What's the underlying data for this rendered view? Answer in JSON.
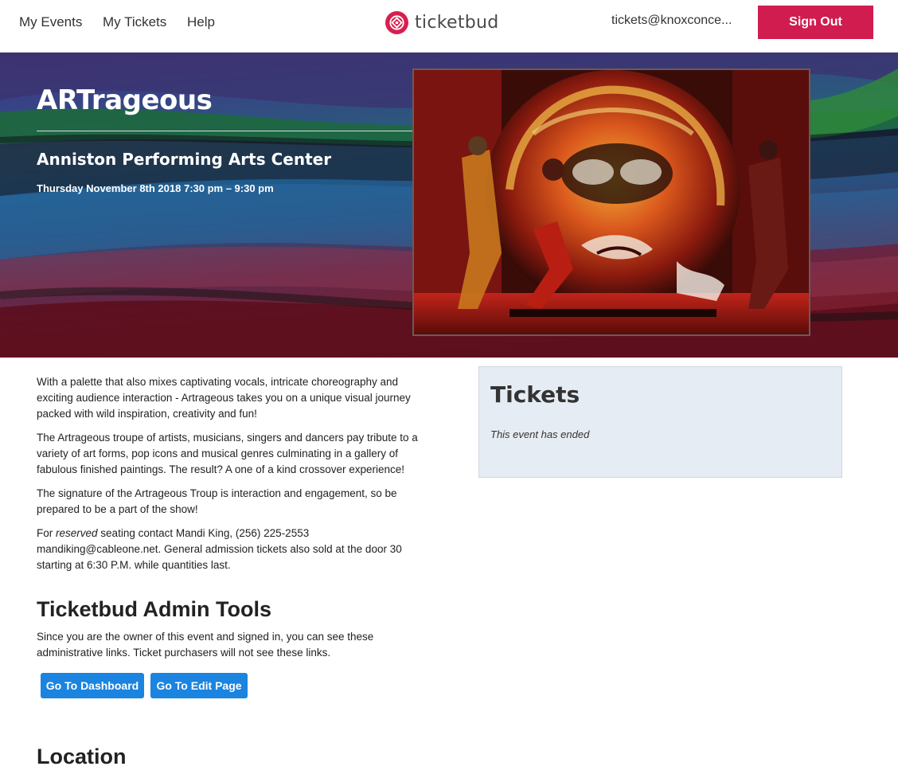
{
  "nav": {
    "links": [
      "My Events",
      "My Tickets",
      "Help"
    ],
    "logo_text": "ticketbud",
    "user_email": "tickets@knoxconce...",
    "signout_label": "Sign Out"
  },
  "event": {
    "title": "ARTrageous",
    "venue": "Anniston Performing Arts Center",
    "datetime": "Thursday November 8th 2018 7:30 pm –  9:30 pm",
    "description": [
      "With a palette that also mixes captivating vocals, intricate choreography and exciting audience interaction - Artrageous takes you on a unique visual journey packed with wild inspiration, creativity and fun!",
      "The Artrageous troupe of artists, musicians, singers and dancers pay tribute to a variety of art forms, pop icons and musical genres culminating in a gallery of fabulous finished paintings. The result? A one of a kind crossover experience!",
      "The signature of the Artrageous Troup is interaction and engagement, so be prepared to be a part of the show!"
    ],
    "reserved_prefix": "For ",
    "reserved_word": "reserved",
    "reserved_rest": " seating contact Mandi King, (256) 225-2553 mandiking@cableone.net. General admission tickets also sold at the door 30 starting at 6:30 P.M. while quantities last."
  },
  "tickets": {
    "title": "Tickets",
    "status": "This event has ended"
  },
  "admin": {
    "title": "Ticketbud Admin Tools",
    "text": "Since you are the owner of this event and signed in, you can see these administrative links. Ticket purchasers will not see these links.",
    "dashboard_label": "Go To Dashboard",
    "edit_label": "Go To Edit Page"
  },
  "location": {
    "title": "Location"
  },
  "colors": {
    "brand": "#d01c4e",
    "button_blue": "#1a84e0",
    "tickets_bg": "#e6ecf3"
  },
  "icons": {
    "logo": "ticketbud-logo-icon"
  }
}
